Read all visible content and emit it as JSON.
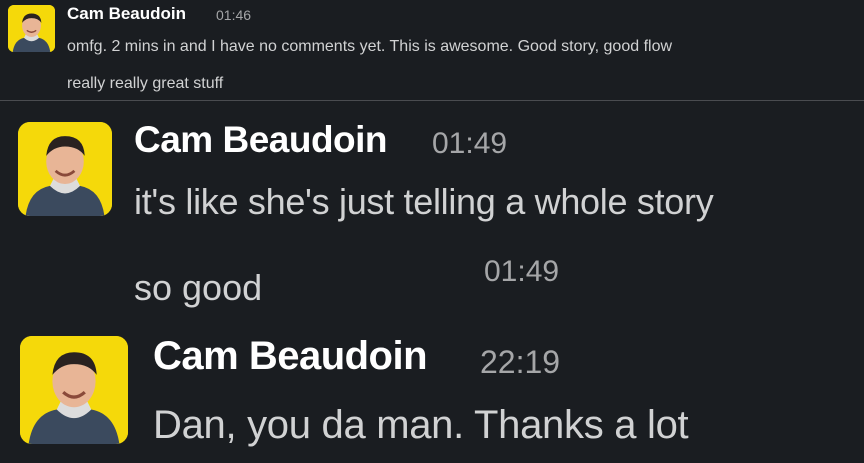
{
  "messages": [
    {
      "author": "Cam Beaudoin",
      "time": "01:46",
      "lines": [
        "omfg. 2 mins in and I have no comments yet. This is awesome. Good story, good flow",
        "really really great stuff"
      ]
    },
    {
      "author": "Cam Beaudoin",
      "time": "01:49",
      "text": "it's like she's just telling a whole story",
      "followup": {
        "text": "so good",
        "time": "01:49"
      }
    },
    {
      "author": "Cam Beaudoin",
      "time": "22:19",
      "text": "Dan, you da man. Thanks a lot"
    }
  ],
  "colors": {
    "background": "#1a1d21",
    "avatar_bg": "#f5d90a",
    "name": "#ffffff",
    "text": "#d1d2d3",
    "timestamp": "#a5a6a8"
  }
}
